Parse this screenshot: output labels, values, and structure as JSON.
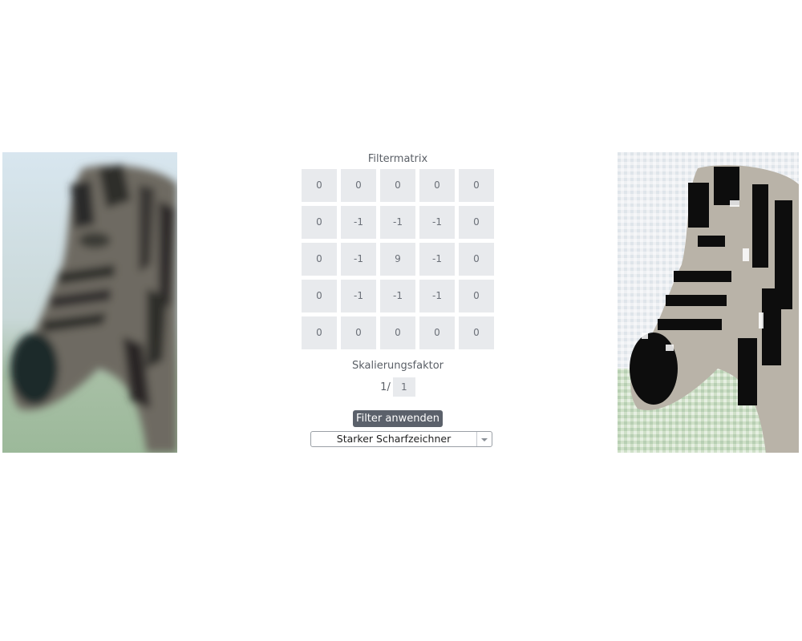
{
  "images": {
    "original": "zebra-original",
    "filtered": "zebra-filtered"
  },
  "filter": {
    "title": "Filtermatrix",
    "matrix": [
      [
        "0",
        "0",
        "0",
        "0",
        "0"
      ],
      [
        "0",
        "-1",
        "-1",
        "-1",
        "0"
      ],
      [
        "0",
        "-1",
        "9",
        "-1",
        "0"
      ],
      [
        "0",
        "-1",
        "-1",
        "-1",
        "0"
      ],
      [
        "0",
        "0",
        "0",
        "0",
        "0"
      ]
    ],
    "scale_label": "Skalierungsfaktor",
    "scale_prefix": "1/",
    "scale_value": "1",
    "apply_label": "Filter anwenden",
    "preset_selected": "Starker Scharfzeichner"
  }
}
